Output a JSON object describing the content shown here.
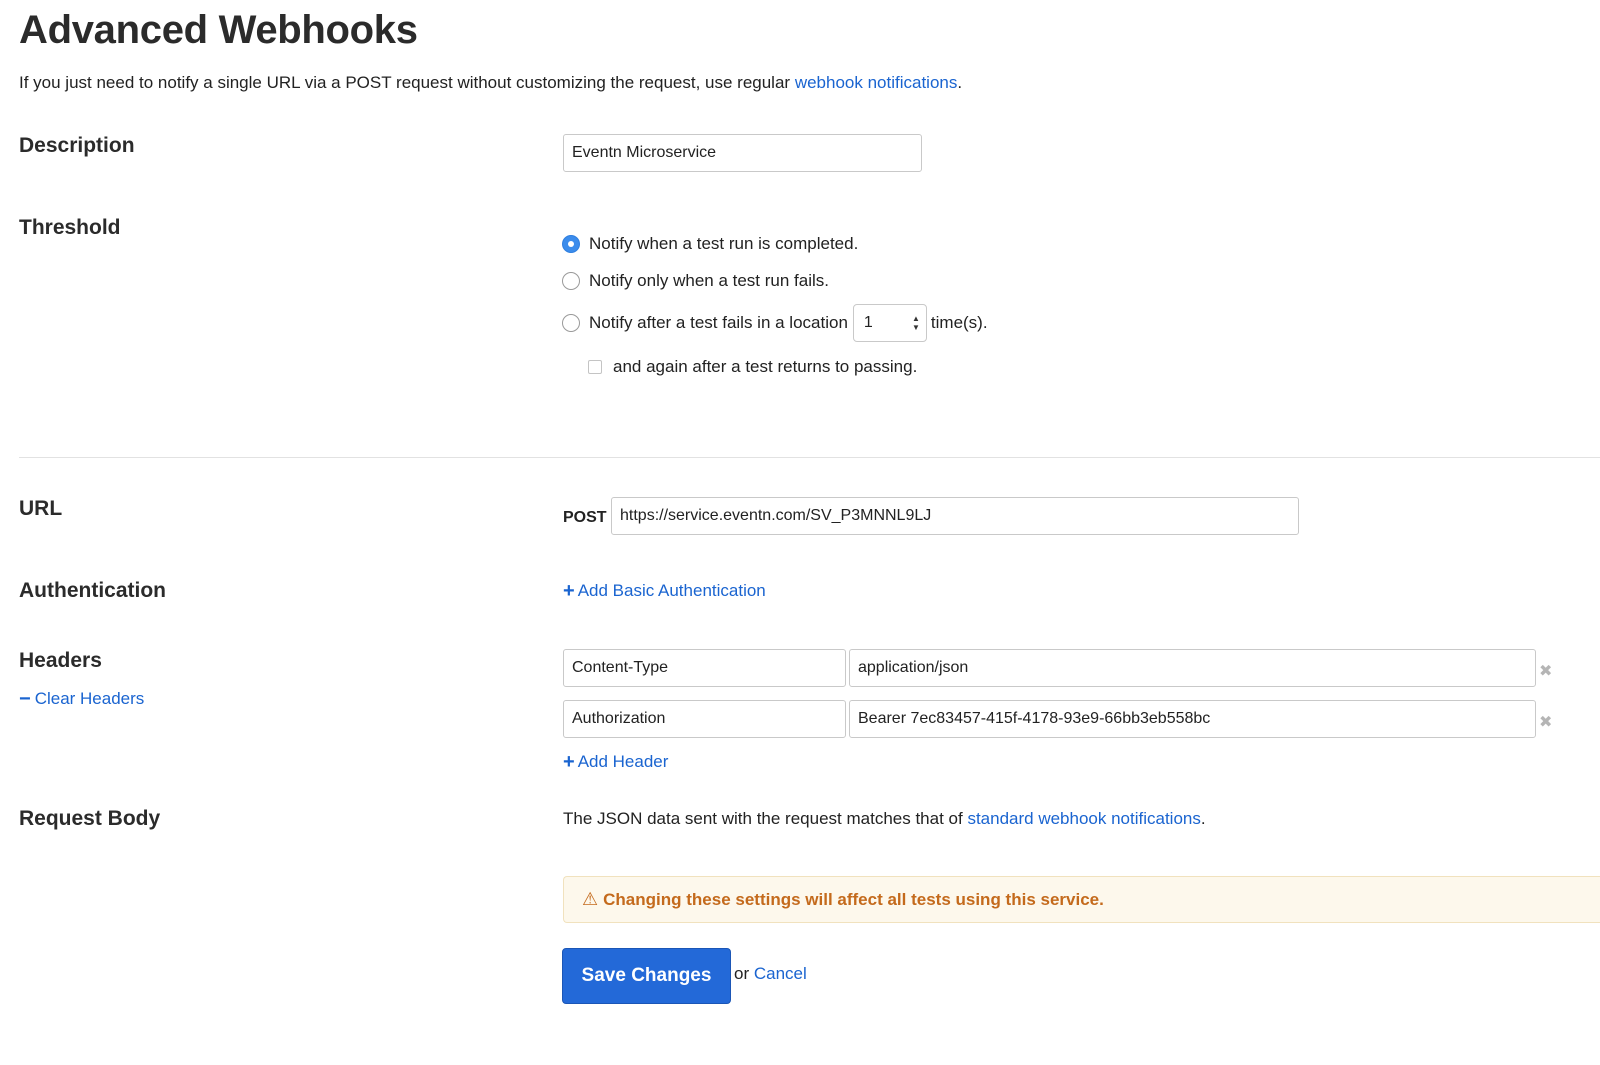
{
  "page": {
    "title": "Advanced Webhooks",
    "intro_text": "If you just need to notify a single URL via a POST request without customizing the request, use regular ",
    "intro_link": "webhook notifications",
    "intro_end": "."
  },
  "description": {
    "label": "Description",
    "value": "Eventn Microservice"
  },
  "threshold": {
    "label": "Threshold",
    "option_completed": "Notify when a test run is completed.",
    "option_fails": "Notify only when a test run fails.",
    "option_location_prefix": "Notify after a test fails in a location",
    "location_count": "1",
    "location_suffix": "time(s).",
    "again_label": "and again after a test returns to passing.",
    "selected": "completed"
  },
  "url": {
    "label": "URL",
    "method": "POST",
    "value": "https://service.eventn.com/SV_P3MNNL9LJ"
  },
  "authentication": {
    "label": "Authentication",
    "add_label": "Add Basic Authentication"
  },
  "headers": {
    "label": "Headers",
    "clear_label": "Clear Headers",
    "rows": [
      {
        "name": "Content-Type",
        "value": "application/json"
      },
      {
        "name": "Authorization",
        "value": "Bearer 7ec83457-415f-4178-93e9-66bb3eb558bc"
      }
    ],
    "add_label": "Add Header"
  },
  "request_body": {
    "label": "Request Body",
    "text": "The JSON data sent with the request matches that of ",
    "link": "standard webhook notifications",
    "text_end": "."
  },
  "alert": {
    "text": "Changing these settings will affect all tests using this service."
  },
  "actions": {
    "save_label": "Save Changes",
    "or_text": "or",
    "cancel_label": "Cancel"
  },
  "colors": {
    "link": "#1a64d0",
    "primary_button": "#2369d8",
    "warning_text": "#c46a1c",
    "warning_bg": "#fdf8ec"
  }
}
